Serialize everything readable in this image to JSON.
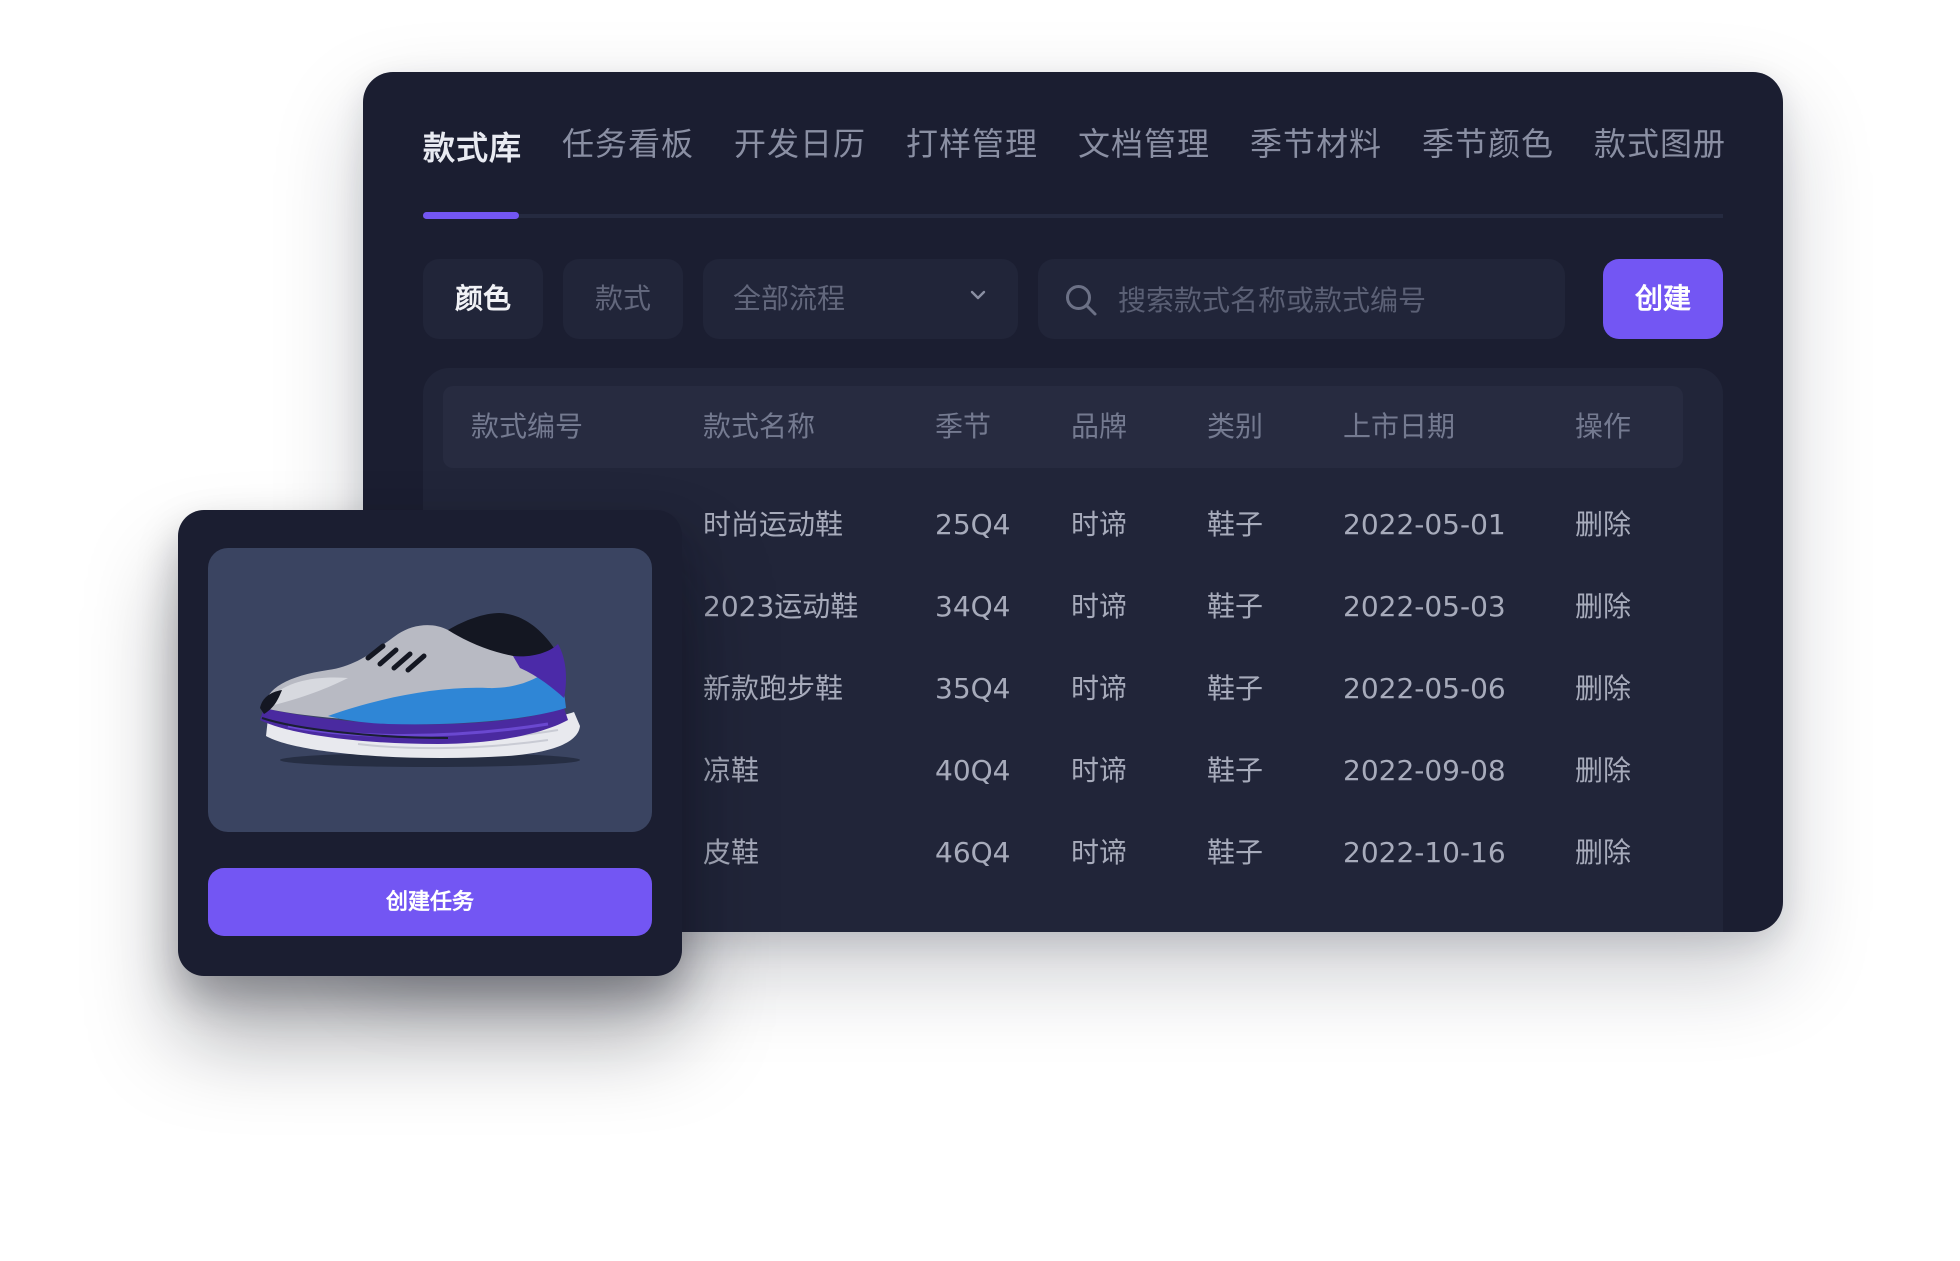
{
  "tabs": [
    {
      "label": "款式库",
      "active": true
    },
    {
      "label": "任务看板",
      "active": false
    },
    {
      "label": "开发日历",
      "active": false
    },
    {
      "label": "打样管理",
      "active": false
    },
    {
      "label": "文档管理",
      "active": false
    },
    {
      "label": "季节材料",
      "active": false
    },
    {
      "label": "季节颜色",
      "active": false
    },
    {
      "label": "款式图册",
      "active": false
    }
  ],
  "filters": {
    "color_chip": "颜色",
    "style_chip": "款式",
    "process_select": {
      "value": "全部流程"
    },
    "search": {
      "placeholder": "搜索款式名称或款式编号",
      "value": ""
    },
    "create_label": "创建"
  },
  "table": {
    "columns": [
      "款式编号",
      "款式名称",
      "季节",
      "品牌",
      "类别",
      "上市日期",
      "操作"
    ],
    "rows": [
      {
        "name": "时尚运动鞋",
        "season": "25Q4",
        "brand": "时谛",
        "category": "鞋子",
        "date": "2022-05-01",
        "action": "删除"
      },
      {
        "name": "2023运动鞋",
        "season": "34Q4",
        "brand": "时谛",
        "category": "鞋子",
        "date": "2022-05-03",
        "action": "删除"
      },
      {
        "name": "新款跑步鞋",
        "season": "35Q4",
        "brand": "时谛",
        "category": "鞋子",
        "date": "2022-05-06",
        "action": "删除"
      },
      {
        "name": "凉鞋",
        "season": "40Q4",
        "brand": "时谛",
        "category": "鞋子",
        "date": "2022-09-08",
        "action": "删除"
      },
      {
        "name": "皮鞋",
        "season": "46Q4",
        "brand": "时谛",
        "category": "鞋子",
        "date": "2022-10-16",
        "action": "删除"
      }
    ]
  },
  "card": {
    "image": "sneaker-image",
    "button_label": "创建任务"
  },
  "colors": {
    "panel_bg": "#1b1e31",
    "field_bg": "#212539",
    "accent": "#7356f3",
    "text_primary": "#e9ebf2",
    "text_secondary": "#8a8fa3"
  }
}
